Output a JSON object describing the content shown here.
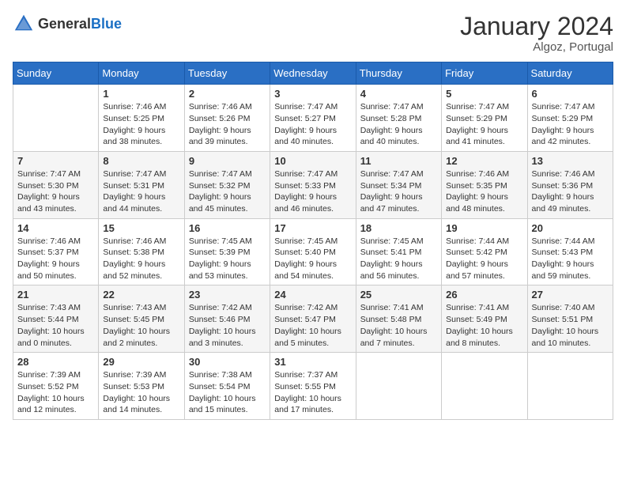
{
  "logo": {
    "general": "General",
    "blue": "Blue"
  },
  "header": {
    "month": "January 2024",
    "location": "Algoz, Portugal"
  },
  "weekdays": [
    "Sunday",
    "Monday",
    "Tuesday",
    "Wednesday",
    "Thursday",
    "Friday",
    "Saturday"
  ],
  "weeks": [
    [
      {
        "day": "",
        "info": ""
      },
      {
        "day": "1",
        "info": "Sunrise: 7:46 AM\nSunset: 5:25 PM\nDaylight: 9 hours\nand 38 minutes."
      },
      {
        "day": "2",
        "info": "Sunrise: 7:46 AM\nSunset: 5:26 PM\nDaylight: 9 hours\nand 39 minutes."
      },
      {
        "day": "3",
        "info": "Sunrise: 7:47 AM\nSunset: 5:27 PM\nDaylight: 9 hours\nand 40 minutes."
      },
      {
        "day": "4",
        "info": "Sunrise: 7:47 AM\nSunset: 5:28 PM\nDaylight: 9 hours\nand 40 minutes."
      },
      {
        "day": "5",
        "info": "Sunrise: 7:47 AM\nSunset: 5:29 PM\nDaylight: 9 hours\nand 41 minutes."
      },
      {
        "day": "6",
        "info": "Sunrise: 7:47 AM\nSunset: 5:29 PM\nDaylight: 9 hours\nand 42 minutes."
      }
    ],
    [
      {
        "day": "7",
        "info": "Sunrise: 7:47 AM\nSunset: 5:30 PM\nDaylight: 9 hours\nand 43 minutes."
      },
      {
        "day": "8",
        "info": "Sunrise: 7:47 AM\nSunset: 5:31 PM\nDaylight: 9 hours\nand 44 minutes."
      },
      {
        "day": "9",
        "info": "Sunrise: 7:47 AM\nSunset: 5:32 PM\nDaylight: 9 hours\nand 45 minutes."
      },
      {
        "day": "10",
        "info": "Sunrise: 7:47 AM\nSunset: 5:33 PM\nDaylight: 9 hours\nand 46 minutes."
      },
      {
        "day": "11",
        "info": "Sunrise: 7:47 AM\nSunset: 5:34 PM\nDaylight: 9 hours\nand 47 minutes."
      },
      {
        "day": "12",
        "info": "Sunrise: 7:46 AM\nSunset: 5:35 PM\nDaylight: 9 hours\nand 48 minutes."
      },
      {
        "day": "13",
        "info": "Sunrise: 7:46 AM\nSunset: 5:36 PM\nDaylight: 9 hours\nand 49 minutes."
      }
    ],
    [
      {
        "day": "14",
        "info": "Sunrise: 7:46 AM\nSunset: 5:37 PM\nDaylight: 9 hours\nand 50 minutes."
      },
      {
        "day": "15",
        "info": "Sunrise: 7:46 AM\nSunset: 5:38 PM\nDaylight: 9 hours\nand 52 minutes."
      },
      {
        "day": "16",
        "info": "Sunrise: 7:45 AM\nSunset: 5:39 PM\nDaylight: 9 hours\nand 53 minutes."
      },
      {
        "day": "17",
        "info": "Sunrise: 7:45 AM\nSunset: 5:40 PM\nDaylight: 9 hours\nand 54 minutes."
      },
      {
        "day": "18",
        "info": "Sunrise: 7:45 AM\nSunset: 5:41 PM\nDaylight: 9 hours\nand 56 minutes."
      },
      {
        "day": "19",
        "info": "Sunrise: 7:44 AM\nSunset: 5:42 PM\nDaylight: 9 hours\nand 57 minutes."
      },
      {
        "day": "20",
        "info": "Sunrise: 7:44 AM\nSunset: 5:43 PM\nDaylight: 9 hours\nand 59 minutes."
      }
    ],
    [
      {
        "day": "21",
        "info": "Sunrise: 7:43 AM\nSunset: 5:44 PM\nDaylight: 10 hours\nand 0 minutes."
      },
      {
        "day": "22",
        "info": "Sunrise: 7:43 AM\nSunset: 5:45 PM\nDaylight: 10 hours\nand 2 minutes."
      },
      {
        "day": "23",
        "info": "Sunrise: 7:42 AM\nSunset: 5:46 PM\nDaylight: 10 hours\nand 3 minutes."
      },
      {
        "day": "24",
        "info": "Sunrise: 7:42 AM\nSunset: 5:47 PM\nDaylight: 10 hours\nand 5 minutes."
      },
      {
        "day": "25",
        "info": "Sunrise: 7:41 AM\nSunset: 5:48 PM\nDaylight: 10 hours\nand 7 minutes."
      },
      {
        "day": "26",
        "info": "Sunrise: 7:41 AM\nSunset: 5:49 PM\nDaylight: 10 hours\nand 8 minutes."
      },
      {
        "day": "27",
        "info": "Sunrise: 7:40 AM\nSunset: 5:51 PM\nDaylight: 10 hours\nand 10 minutes."
      }
    ],
    [
      {
        "day": "28",
        "info": "Sunrise: 7:39 AM\nSunset: 5:52 PM\nDaylight: 10 hours\nand 12 minutes."
      },
      {
        "day": "29",
        "info": "Sunrise: 7:39 AM\nSunset: 5:53 PM\nDaylight: 10 hours\nand 14 minutes."
      },
      {
        "day": "30",
        "info": "Sunrise: 7:38 AM\nSunset: 5:54 PM\nDaylight: 10 hours\nand 15 minutes."
      },
      {
        "day": "31",
        "info": "Sunrise: 7:37 AM\nSunset: 5:55 PM\nDaylight: 10 hours\nand 17 minutes."
      },
      {
        "day": "",
        "info": ""
      },
      {
        "day": "",
        "info": ""
      },
      {
        "day": "",
        "info": ""
      }
    ]
  ]
}
